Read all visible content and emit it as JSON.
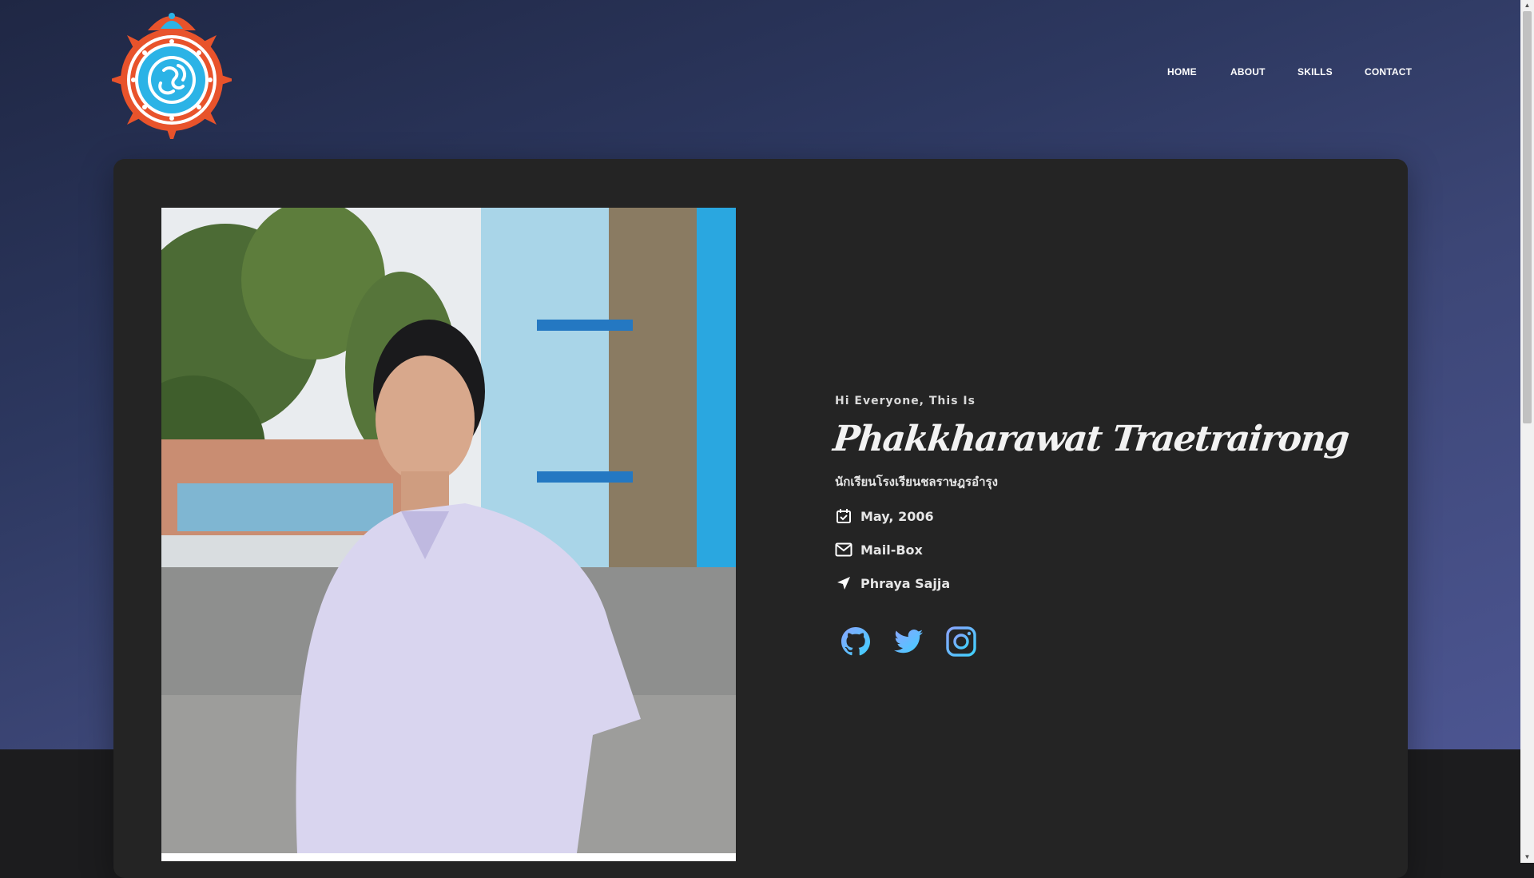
{
  "nav": {
    "links": [
      "HOME",
      "ABOUT",
      "SKILLS",
      "CONTACT"
    ]
  },
  "logo": {
    "icon": "school-emblem-logo"
  },
  "intro": {
    "greeting": "Hi Everyone, This Is",
    "name": "Phakkharawat Traetrairong",
    "subtitle": "นักเรียนโรงเรียนชลราษฎรอำรุง",
    "birth": "May, 2006",
    "email": "Mail-Box",
    "location": "Phraya Sajja"
  },
  "icons": {
    "birth": "calendar-check-icon",
    "email": "envelope-icon",
    "location": "location-arrow-icon",
    "socials": [
      "github-icon",
      "twitter-icon",
      "instagram-icon"
    ]
  },
  "colors": {
    "hero_top": "#1f2744",
    "hero_bottom": "#4c5591",
    "card": "#242424",
    "social_gradient_start": "#7b9cff",
    "social_gradient_end": "#3fd1ff"
  }
}
